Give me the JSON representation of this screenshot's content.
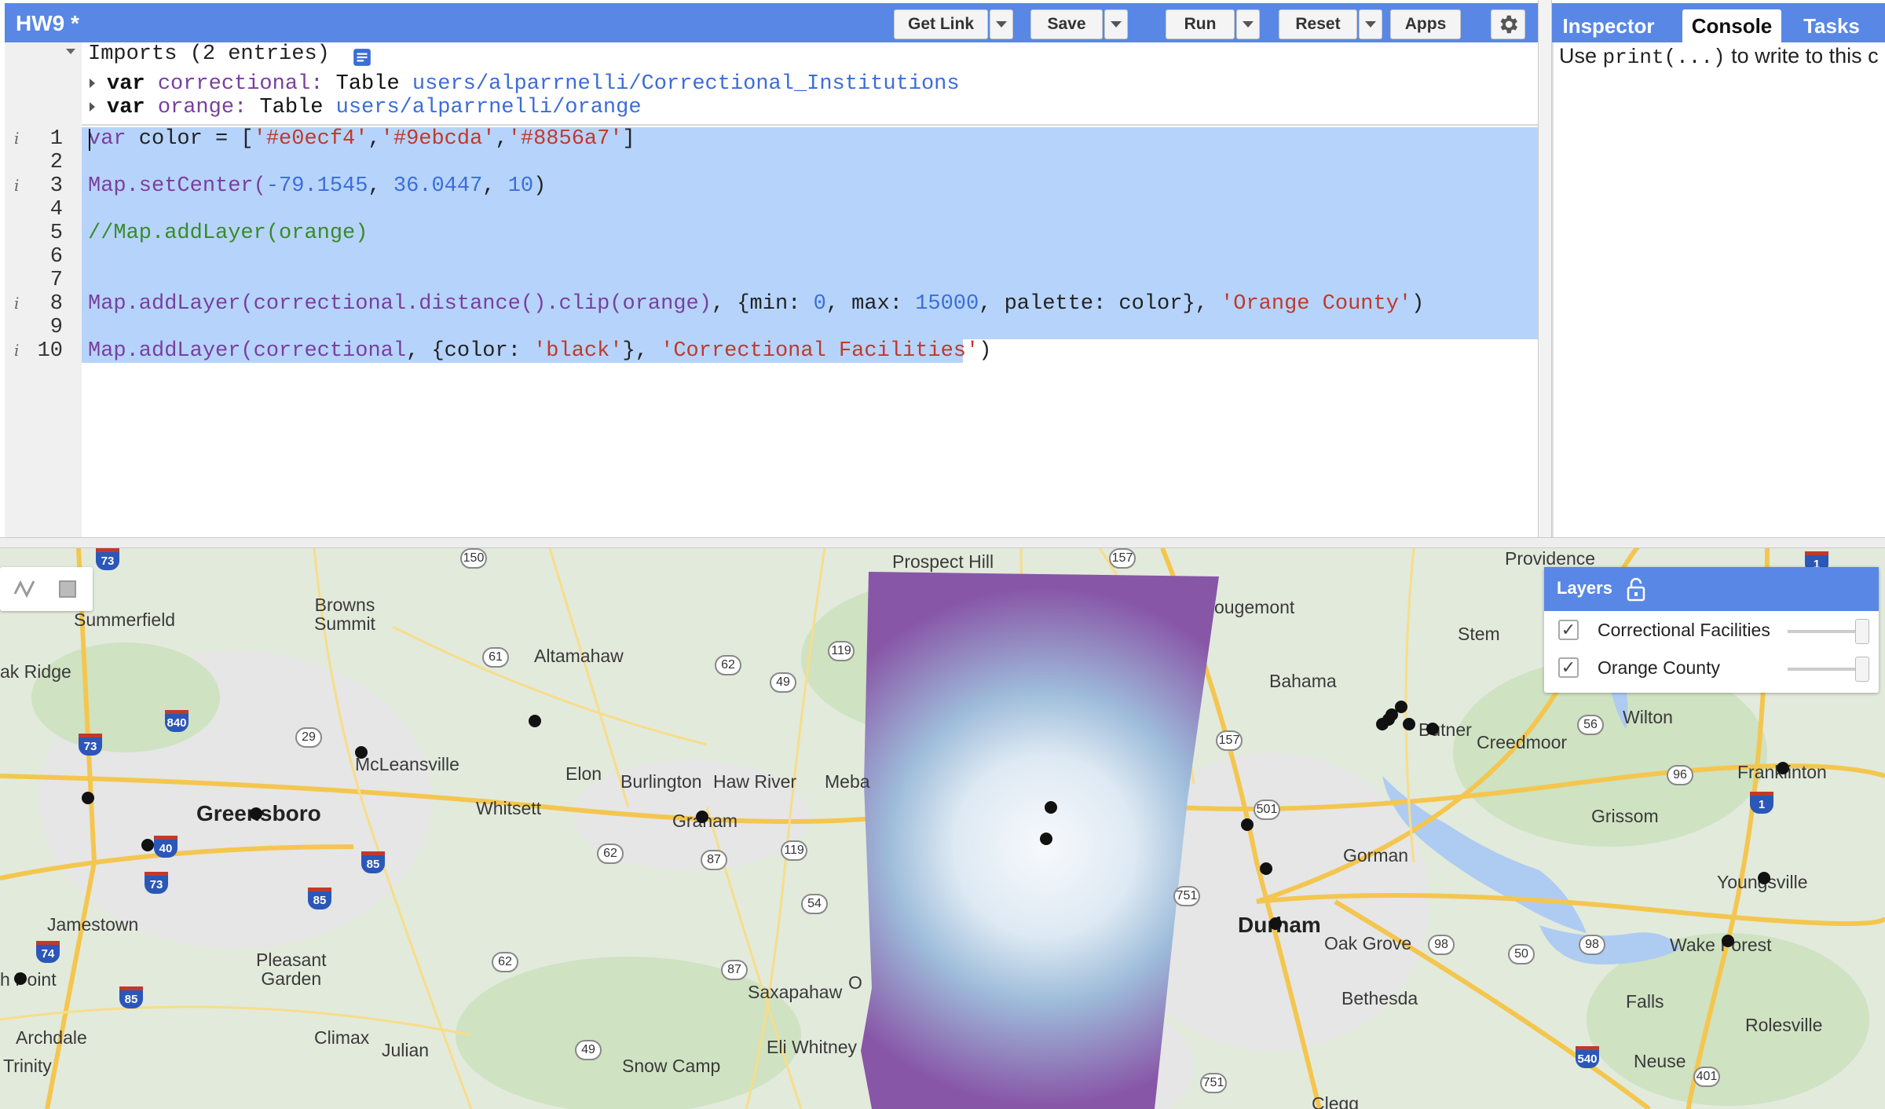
{
  "editor": {
    "title": "HW9 *",
    "buttons": {
      "get_link": "Get Link",
      "save": "Save",
      "run": "Run",
      "reset": "Reset",
      "apps": "Apps"
    },
    "imports": {
      "header": "Imports (2 entries)",
      "rows": [
        {
          "kw": "var",
          "name": "correctional:",
          "type": "Table",
          "path": "users/alparrnelli/Correctional_Institutions"
        },
        {
          "kw": "var",
          "name": "orange:",
          "type": "Table",
          "path": "users/alparrnelli/orange"
        }
      ]
    },
    "line_numbers": [
      "1",
      "2",
      "3",
      "4",
      "5",
      "6",
      "7",
      "8",
      "9",
      "10"
    ],
    "code": {
      "l1_a": "var",
      "l1_b": " color = [",
      "l1_s1": "'#e0ecf4'",
      "l1_c1": ",",
      "l1_s2": "'#9ebcda'",
      "l1_c2": ",",
      "l1_s3": "'#8856a7'",
      "l1_e": "]",
      "l3_fn": "Map.setCenter(",
      "l3_n1": "-79.1545",
      "l3_c1": ", ",
      "l3_n2": "36.0447",
      "l3_c2": ", ",
      "l3_n3": "10",
      "l3_e": ")",
      "l5": "//Map.addLayer(orange)",
      "l8_a": "Map.addLayer(correctional.distance().clip(orange)",
      "l8_b": ", {min: ",
      "l8_n1": "0",
      "l8_c": ", max: ",
      "l8_n2": "15000",
      "l8_d": ", palette: color}, ",
      "l8_s": "'Orange County'",
      "l8_e": ")",
      "l10_a": "Map.addLayer(correctional",
      "l10_b": ", {color: ",
      "l10_s1": "'black'",
      "l10_c": "}, ",
      "l10_s2": "'Correctional Facilities'",
      "l10_e": ")"
    }
  },
  "right_panel": {
    "tabs": [
      "Inspector",
      "Console",
      "Tasks"
    ],
    "active_tab": "Console",
    "console_pre": "Use ",
    "console_code": "print(...)",
    "console_post": " to write to this c"
  },
  "map": {
    "layers_title": "Layers",
    "layers": [
      {
        "name": "Correctional Facilities",
        "checked": true
      },
      {
        "name": "Orange County",
        "checked": true
      }
    ],
    "places": {
      "summerfield": "Summerfield",
      "browns_summit": "Browns\nSummit",
      "oak_ridge": "ak Ridge",
      "altamahaw": "Altamahaw",
      "mcleansville": "McLeansville",
      "greensboro": "Greensboro",
      "whitsett": "Whitsett",
      "elon": "Elon",
      "burlington": "Burlington",
      "haw_river": "Haw River",
      "meba": "Meba",
      "graham": "Graham",
      "jamestown": "Jamestown",
      "pleasant_garden": "Pleasant\nGarden",
      "h_point": "h Point",
      "archdale": "Archdale",
      "climax": "Climax",
      "julian": "Julian",
      "trinity": "Trinity",
      "saxapahaw": "Saxapahaw",
      "o": "O",
      "eli_whitney": "Eli Whitney",
      "snow_camp": "Snow Camp",
      "prospect_hill": "Prospect Hill",
      "providence": "Providence",
      "ougemont": "ougemont",
      "stem": "Stem",
      "bahama": "Bahama",
      "butner": "Butner",
      "creedmoor": "Creedmoor",
      "wilton": "Wilton",
      "franklinton": "Franklinton",
      "grissom": "Grissom",
      "gorman": "Gorman",
      "youngsville": "Youngsville",
      "durham": "Durham",
      "oak_grove": "Oak Grove",
      "wake_forest": "Wake Forest",
      "bethesda": "Bethesda",
      "falls": "Falls",
      "rolesville": "Rolesville",
      "neuse": "Neuse",
      "clegg": "Clegg"
    },
    "shields": [
      "150",
      "157",
      "61",
      "62",
      "49",
      "119",
      "29",
      "157",
      "56",
      "96",
      "501",
      "62",
      "87",
      "119",
      "54",
      "751",
      "98",
      "50",
      "98",
      "62",
      "87",
      "49",
      "751",
      "401"
    ],
    "interstates": [
      "73",
      "840",
      "73",
      "40",
      "73",
      "85",
      "85",
      "74",
      "85",
      "1",
      "540",
      "1"
    ],
    "colors": {
      "palette": [
        "#e0ecf4",
        "#9ebcda",
        "#8856a7"
      ],
      "facility": "#000000",
      "accent": "#5887e6"
    }
  }
}
